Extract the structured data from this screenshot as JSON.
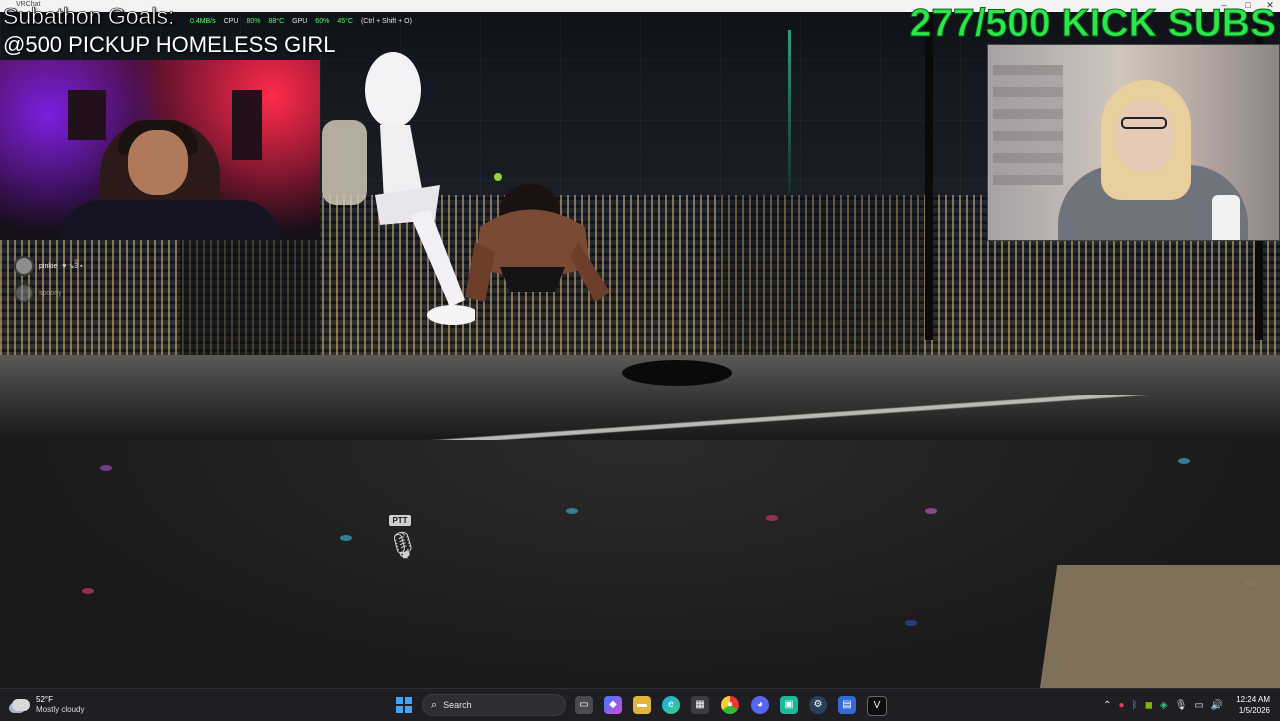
{
  "window": {
    "title": "VRChat",
    "controls": [
      "–",
      "□",
      "✕"
    ]
  },
  "perf": {
    "net": "0.4MB/s",
    "cpu_label": "CPU",
    "cpu_load": "80%",
    "cpu_temp": "88°C",
    "gpu_label": "GPU",
    "gpu_load": "60%",
    "gpu_temp": "45°C",
    "hotkey": "(Ctrl + Shift + O)"
  },
  "overlay": {
    "goal_title": "Subathon Goals:",
    "goal_line": "@500 PICKUP HOMELESS GIRL",
    "subs_counter": "277/500 KICK SUBS",
    "subs_color": "#29e84a"
  },
  "voice_list": [
    {
      "name": "pinkie",
      "icons": "♥ ↘3 ▪"
    },
    {
      "name": "spoony",
      "icons": ""
    }
  ],
  "ptt": {
    "tag": "PTT",
    "icon": "microphone-icon"
  },
  "taskbar": {
    "weather_temp": "52°F",
    "weather_condition": "Mostly cloudy",
    "search_placeholder": "Search",
    "apps": [
      "task-view-icon",
      "copilot-icon",
      "file-explorer-icon",
      "edge-icon",
      "store-icon",
      "chrome-icon",
      "discord-icon",
      "app-icon",
      "steam-icon",
      "bookmark-icon",
      "vrchat-icon"
    ],
    "tray_icons": [
      "chevron-up-icon",
      "onedrive-icon",
      "bluetooth-icon",
      "nvidia-icon",
      "shield-icon",
      "microphone-icon",
      "display-icon",
      "speaker-icon"
    ],
    "time": "12:24 AM",
    "date": "1/5/2026"
  }
}
